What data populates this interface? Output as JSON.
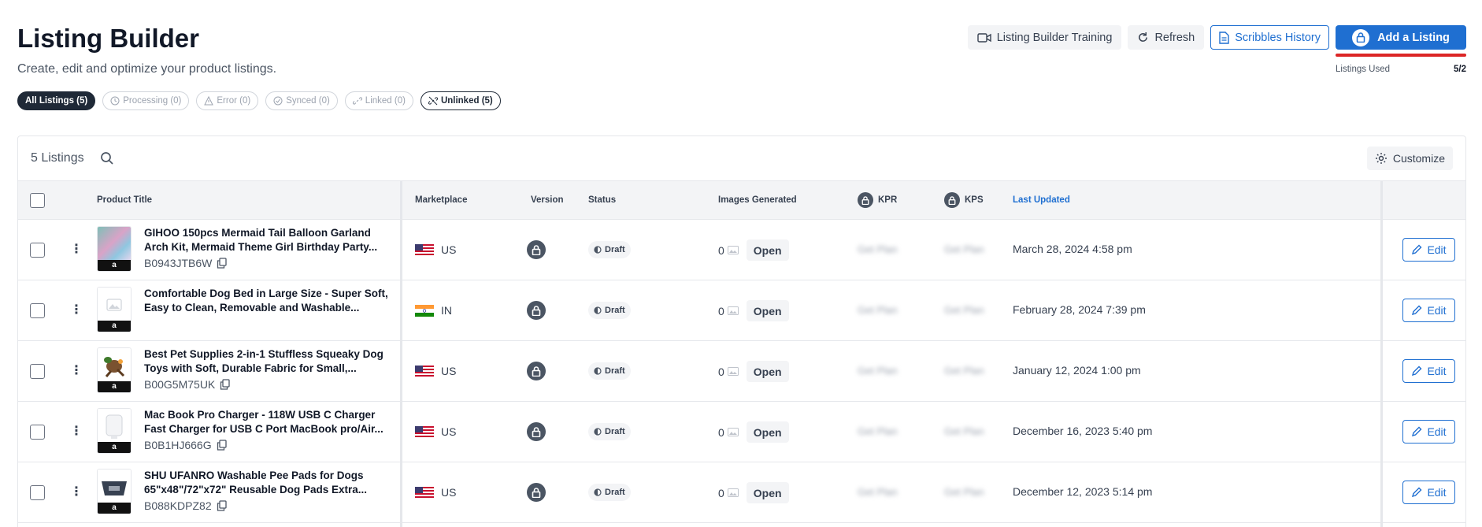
{
  "header": {
    "title": "Listing Builder",
    "subtitle": "Create, edit and optimize your product listings."
  },
  "filters": [
    {
      "label": "All Listings (5)"
    },
    {
      "label": "Processing (0)"
    },
    {
      "label": "Error (0)"
    },
    {
      "label": "Synced (0)"
    },
    {
      "label": "Linked (0)"
    },
    {
      "label": "Unlinked (5)"
    }
  ],
  "actions": {
    "training": "Listing Builder Training",
    "refresh": "Refresh",
    "history": "Scribbles History",
    "add": "Add a Listing"
  },
  "usage": {
    "label": "Listings Used",
    "value": "5/2"
  },
  "table": {
    "count": "5 Listings",
    "customize": "Customize",
    "columns": {
      "product_title": "Product Title",
      "marketplace": "Marketplace",
      "version": "Version",
      "status": "Status",
      "images": "Images Generated",
      "kpr": "KPR",
      "kps": "KPS",
      "updated": "Last Updated"
    },
    "rows": [
      {
        "title": "GIHOO 150pcs Mermaid Tail Balloon Garland Arch Kit, Mermaid Theme Girl Birthday Party...",
        "asin": "B0943JTB6W",
        "marketplace": "US",
        "status": "Draft",
        "images": "0",
        "open": "Open",
        "kpr": "Get Plan",
        "kps": "Get Plan",
        "updated": "March 28, 2024 4:58 pm",
        "edit": "Edit",
        "amz": "a"
      },
      {
        "title": "Comfortable Dog Bed in Large Size - Super Soft, Easy to Clean, Removable and Washable...",
        "asin": "",
        "marketplace": "IN",
        "status": "Draft",
        "images": "0",
        "open": "Open",
        "kpr": "Get Plan",
        "kps": "Get Plan",
        "updated": "February 28, 2024 7:39 pm",
        "edit": "Edit",
        "amz": "a"
      },
      {
        "title": "Best Pet Supplies 2-in-1 Stuffless Squeaky Dog Toys with Soft, Durable Fabric for Small,...",
        "asin": "B00G5M75UK",
        "marketplace": "US",
        "status": "Draft",
        "images": "0",
        "open": "Open",
        "kpr": "Get Plan",
        "kps": "Get Plan",
        "updated": "January 12, 2024 1:00 pm",
        "edit": "Edit",
        "amz": "a"
      },
      {
        "title": "Mac Book Pro Charger - 118W USB C Charger Fast Charger for USB C Port MacBook pro/Air...",
        "asin": "B0B1HJ666G",
        "marketplace": "US",
        "status": "Draft",
        "images": "0",
        "open": "Open",
        "kpr": "Get Plan",
        "kps": "Get Plan",
        "updated": "December 16, 2023 5:40 pm",
        "edit": "Edit",
        "amz": "a"
      },
      {
        "title": "SHU UFANRO Washable Pee Pads for Dogs 65\"x48\"/72\"x72\" Reusable Dog Pads Extra...",
        "asin": "B088KDPZ82",
        "marketplace": "US",
        "status": "Draft",
        "images": "0",
        "open": "Open",
        "kpr": "Get Plan",
        "kps": "Get Plan",
        "updated": "December 12, 2023 5:14 pm",
        "edit": "Edit",
        "amz": "a"
      }
    ]
  },
  "colors": {
    "primary": "#1f6fd1",
    "usage_bar": "#dc2626",
    "chip_active": "#1f2937"
  }
}
